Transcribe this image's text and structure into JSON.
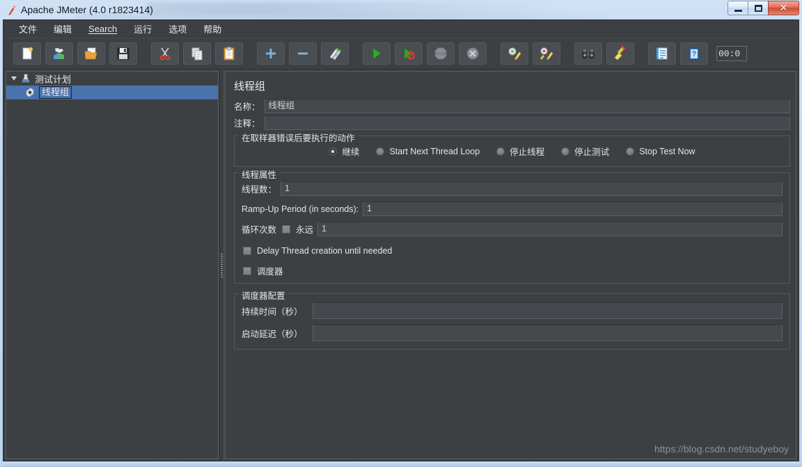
{
  "window": {
    "title": "Apache JMeter (4.0 r1823414)",
    "app_icon": "jmeter-feather-icon",
    "minimize_label": "Minimize",
    "maximize_label": "Restore",
    "close_label": "Close"
  },
  "menubar": {
    "items": [
      {
        "label": "文件",
        "name": "menu-file"
      },
      {
        "label": "编辑",
        "name": "menu-edit"
      },
      {
        "label": "Search",
        "name": "menu-search",
        "mnemonic": true
      },
      {
        "label": "运行",
        "name": "menu-run"
      },
      {
        "label": "选项",
        "name": "menu-options"
      },
      {
        "label": "帮助",
        "name": "menu-help"
      }
    ]
  },
  "toolbar": {
    "buttons": [
      {
        "name": "new-button",
        "icon": "new-document-icon"
      },
      {
        "name": "templates-button",
        "icon": "templates-icon"
      },
      {
        "name": "open-button",
        "icon": "open-folder-icon"
      },
      {
        "name": "save-button",
        "icon": "save-floppy-icon"
      },
      {
        "name": "cut-button",
        "icon": "scissors-icon"
      },
      {
        "name": "copy-button",
        "icon": "copy-icon"
      },
      {
        "name": "paste-button",
        "icon": "clipboard-paste-icon"
      },
      {
        "name": "expand-all-button",
        "icon": "plus-icon"
      },
      {
        "name": "collapse-all-button",
        "icon": "minus-icon"
      },
      {
        "name": "toggle-button",
        "icon": "toggle-pencil-icon"
      },
      {
        "name": "start-button",
        "icon": "play-green-icon"
      },
      {
        "name": "start-no-pauses-button",
        "icon": "play-no-pause-icon"
      },
      {
        "name": "stop-button",
        "icon": "stop-sign-icon"
      },
      {
        "name": "shutdown-button",
        "icon": "shutdown-x-icon"
      },
      {
        "name": "clear-button",
        "icon": "gear-broom-icon"
      },
      {
        "name": "clear-all-button",
        "icon": "gear-broom-all-icon"
      },
      {
        "name": "search-button",
        "icon": "binoculars-icon"
      },
      {
        "name": "reset-search-button",
        "icon": "broom-icon"
      },
      {
        "name": "function-helper-button",
        "icon": "notepad-list-icon"
      },
      {
        "name": "help-button",
        "icon": "help-book-icon"
      }
    ],
    "timer_value": "00:0"
  },
  "tree": {
    "root": {
      "label": "测试计划",
      "icon": "test-plan-icon",
      "expanded": true
    },
    "children": [
      {
        "label": "线程组",
        "icon": "thread-group-gear-icon",
        "selected": true
      }
    ]
  },
  "main": {
    "panel_title": "线程组",
    "name_field": {
      "label": "名称：",
      "value": "线程组"
    },
    "comment_field": {
      "label": "注释：",
      "value": ""
    },
    "error_action": {
      "legend": "在取样器错误后要执行的动作",
      "options": [
        {
          "label": "继续",
          "selected": true
        },
        {
          "label": "Start Next Thread Loop",
          "selected": false
        },
        {
          "label": "停止线程",
          "selected": false
        },
        {
          "label": "停止测试",
          "selected": false
        },
        {
          "label": "Stop Test Now",
          "selected": false
        }
      ]
    },
    "thread_properties": {
      "legend": "线程属性",
      "num_threads": {
        "label": "线程数：",
        "value": "1"
      },
      "ramp_up": {
        "label": "Ramp-Up Period (in seconds):",
        "value": "1"
      },
      "loop_count": {
        "label": "循环次数",
        "forever_label": "永远",
        "forever_checked": false,
        "value": "1"
      },
      "delay_thread_creation": {
        "label": "Delay Thread creation until needed",
        "checked": false
      },
      "scheduler_checkbox": {
        "label": "调度器",
        "checked": false
      }
    },
    "scheduler_config": {
      "legend": "调度器配置",
      "duration": {
        "label": "持续时间（秒）",
        "value": ""
      },
      "startup_delay": {
        "label": "启动延迟（秒）",
        "value": ""
      }
    }
  },
  "watermark": {
    "text": "https://blog.csdn.net/studyeboy"
  },
  "colors": {
    "panel_bg": "#3c4043",
    "field_bg": "#45494d",
    "selection_blue": "#4a72ad",
    "text": "#e4e6e8",
    "window_chrome": "#c2d8f0"
  }
}
